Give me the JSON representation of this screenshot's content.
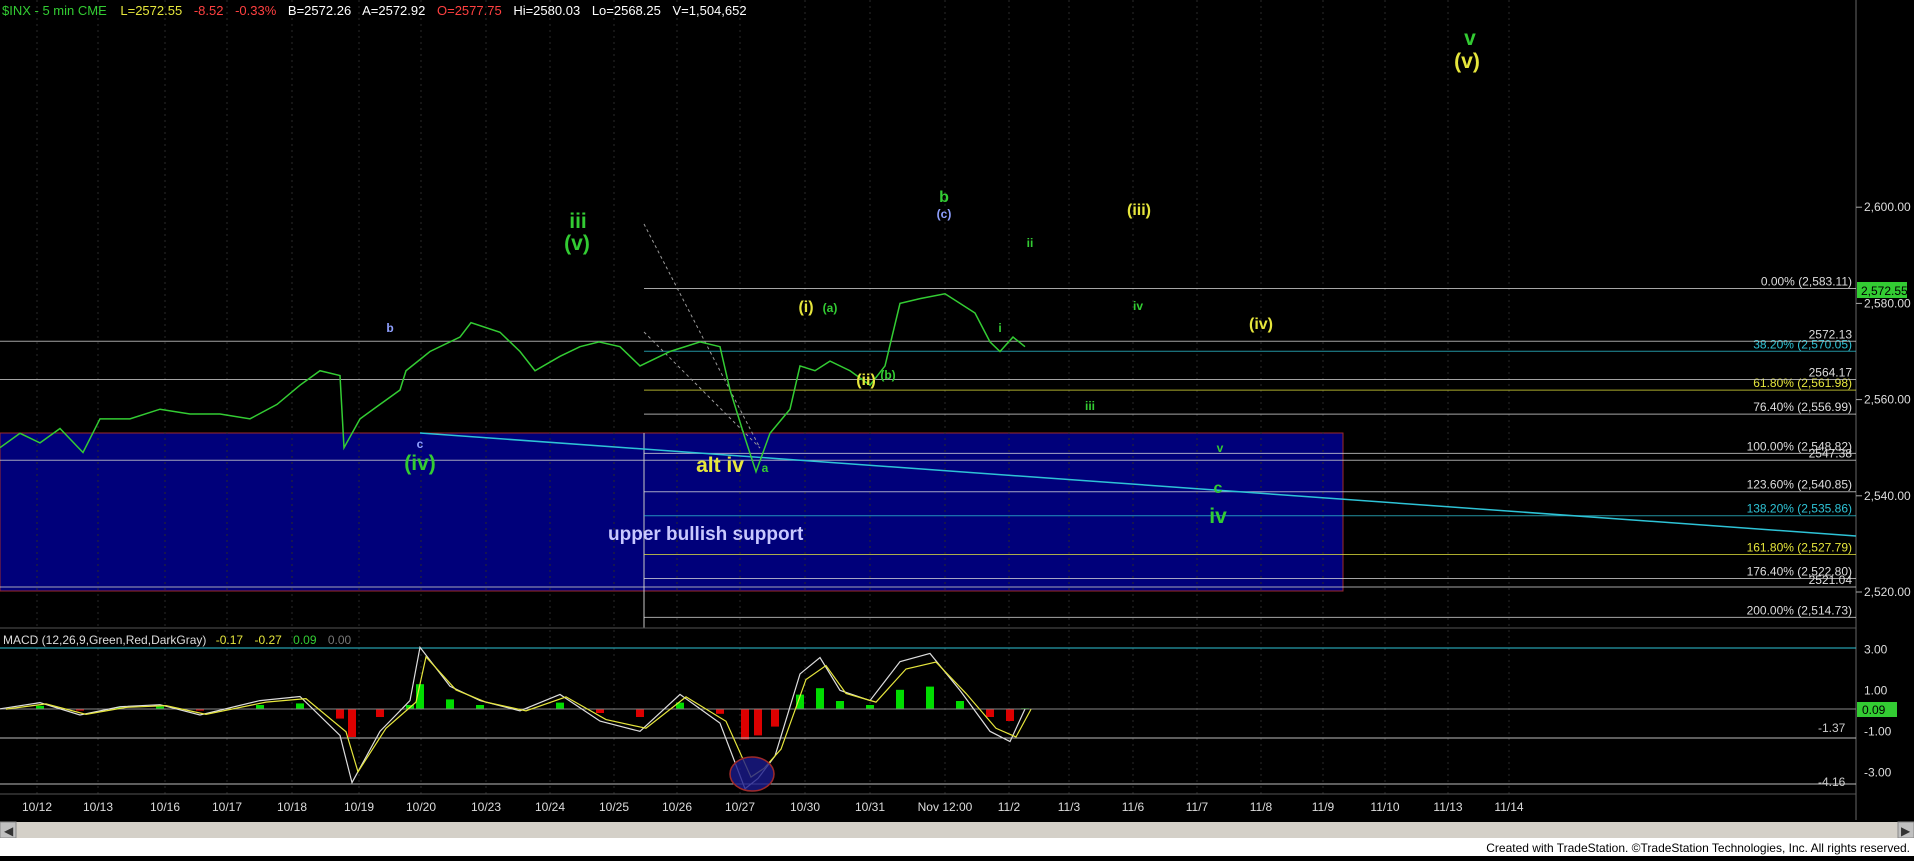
{
  "header": {
    "symbol": "$INX - 5 min  CME",
    "last": "L=2572.55",
    "change": "-8.52",
    "pct": "-0.33%",
    "bid": "B=2572.26",
    "ask": "A=2572.92",
    "open": "O=2577.75",
    "hi": "Hi=2580.03",
    "lo": "Lo=2568.25",
    "vol": "V=1,504,652"
  },
  "footer": {
    "credit": "Created with TradeStation. ©TradeStation Technologies, Inc. All rights reserved."
  },
  "colors": {
    "bg": "#000000",
    "price": "#33cc33",
    "green": "#33cc33",
    "yellow": "#e6e63c",
    "blue": "#00007a",
    "fib_line": "#c8c8c8",
    "macd_up": "#00dd00",
    "macd_down": "#dd0000"
  },
  "chart_data": [
    {
      "type": "line",
      "title": "$INX - 5 min",
      "x_ticks": [
        "10/12",
        "10/13",
        "10/16",
        "10/17",
        "10/18",
        "10/19",
        "10/20",
        "10/23",
        "10/24",
        "10/25",
        "10/26",
        "10/27",
        "10/30",
        "10/31",
        "Nov 12:00",
        "11/2",
        "11/3",
        "11/6",
        "11/7",
        "11/8",
        "11/9",
        "11/10",
        "11/13",
        "11/14"
      ],
      "y_ticks": [
        "2,600.00",
        "2,580.00",
        "2,560.00",
        "2,540.00",
        "2,520.00"
      ],
      "ylim": [
        2508,
        2637
      ],
      "price_labels": [
        {
          "text": "2572.13",
          "value": 2572.13
        },
        {
          "text": "2564.17",
          "value": 2564.17
        },
        {
          "text": "2547.38",
          "value": 2547.38
        },
        {
          "text": "2521.04",
          "value": 2521.04
        }
      ],
      "last_price": "2,572.55",
      "fib_levels": [
        {
          "label": "0.00% (2,583.11)",
          "value": 2583.11
        },
        {
          "label": "38.20% (2,570.05)",
          "value": 2570.05
        },
        {
          "label": "61.80% (2,561.98)",
          "value": 2561.98
        },
        {
          "label": "76.40% (2,556.99)",
          "value": 2556.99
        },
        {
          "label": "100.00% (2,548.82)",
          "value": 2548.82
        },
        {
          "label": "123.60% (2,540.85)",
          "value": 2540.85
        },
        {
          "label": "138.20% (2,535.86)",
          "value": 2535.86
        },
        {
          "label": "161.80% (2,527.79)",
          "value": 2527.79
        },
        {
          "label": "176.40% (2,522.80)",
          "value": 2522.8
        },
        {
          "label": "200.00% (2,514.73)",
          "value": 2514.73
        }
      ],
      "support_zone": {
        "label": "upper bullish support",
        "from": 2521.04,
        "to": 2547.38
      },
      "wave_labels": [
        {
          "text": "iii",
          "color": "green",
          "size": "big"
        },
        {
          "text": "(v)",
          "color": "green",
          "size": "big"
        },
        {
          "text": "b",
          "color": "blue",
          "size": "small"
        },
        {
          "text": "c",
          "color": "blue",
          "size": "small"
        },
        {
          "text": "(iv)",
          "color": "green",
          "size": "big"
        },
        {
          "text": "alt iv",
          "color": "yellow",
          "size": "big"
        },
        {
          "text": "a",
          "color": "green",
          "size": "small"
        },
        {
          "text": "(i)",
          "color": "yellow",
          "size": "mid"
        },
        {
          "text": "(a)",
          "color": "green",
          "size": "small"
        },
        {
          "text": "(ii)",
          "color": "yellow",
          "size": "mid"
        },
        {
          "text": "(b)",
          "color": "green",
          "size": "small"
        },
        {
          "text": "b",
          "color": "green",
          "size": "mid"
        },
        {
          "text": "(c)",
          "color": "blue",
          "size": "small"
        },
        {
          "text": "ii",
          "color": "green",
          "size": "small"
        },
        {
          "text": "i",
          "color": "green",
          "size": "small"
        },
        {
          "text": "iv",
          "color": "green",
          "size": "small"
        },
        {
          "text": "iii",
          "color": "green",
          "size": "small"
        },
        {
          "text": "(iii)",
          "color": "yellow",
          "size": "mid"
        },
        {
          "text": "(iv)",
          "color": "yellow",
          "size": "mid"
        },
        {
          "text": "v",
          "color": "green",
          "size": "small"
        },
        {
          "text": "c",
          "color": "green",
          "size": "mid"
        },
        {
          "text": "iv",
          "color": "green",
          "size": "big"
        },
        {
          "text": "v",
          "color": "green",
          "size": "big"
        },
        {
          "text": "(v)",
          "color": "yellow",
          "size": "big"
        }
      ]
    },
    {
      "type": "line",
      "title": "MACD (12,26,9,Green,Red,DarkGray)",
      "values_text": [
        "-0.17",
        "-0.27",
        "0.09",
        "0.00"
      ],
      "y_ticks": [
        "3.00",
        "1.00",
        "-1.00",
        "-3.00"
      ],
      "ylim": [
        -4.5,
        3.4
      ],
      "ref_lines": [
        {
          "text": "-1.37",
          "value": -1.37
        },
        {
          "text": "-4.16",
          "value": -4.16
        }
      ],
      "last_value": "0.09"
    }
  ]
}
